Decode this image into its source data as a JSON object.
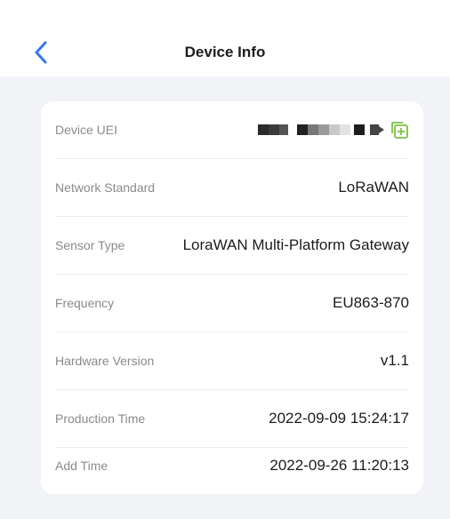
{
  "header": {
    "title": "Device Info",
    "back_icon": "chevron-left-icon"
  },
  "colors": {
    "accent": "#3478f6",
    "copy_icon": "#7ac142",
    "background": "#f2f3f7"
  },
  "device": {
    "rows": [
      {
        "label": "Device UEI",
        "value": ""
      },
      {
        "label": "Network Standard",
        "value": "LoRaWAN"
      },
      {
        "label": "Sensor Type",
        "value": "LoraWAN Multi-Platform Gateway"
      },
      {
        "label": "Frequency",
        "value": "EU863-870"
      },
      {
        "label": "Hardware Version",
        "value": "v1.1"
      },
      {
        "label": "Production Time",
        "value": "2022-09-09 15:24:17"
      },
      {
        "label": "Add Time",
        "value": "2022-09-26 11:20:13"
      }
    ],
    "uei_icon": "copy-icon"
  }
}
